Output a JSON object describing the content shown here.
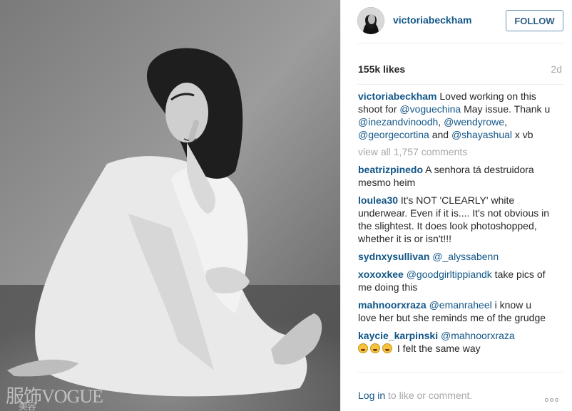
{
  "post": {
    "image_alt": "Black and white photo of a woman sitting on the floor in a white robe",
    "watermark": "服饰VOGUE",
    "watermark_sub": "美容"
  },
  "header": {
    "username": "victoriabeckham",
    "follow_label": "FOLLOW"
  },
  "stats": {
    "likes": "155k likes",
    "time_ago": "2d"
  },
  "caption": {
    "user": "victoriabeckham",
    "text1": " Loved working on this shoot for ",
    "m1": "@voguechina",
    "text2": " May issue. Thank u ",
    "m2": "@inezandvinoodh",
    "text3": ", ",
    "m3": "@wendyrowe",
    "text4": ", ",
    "m4": "@georgecortina",
    "text5": " and ",
    "m5": "@shayashual",
    "text6": " x vb"
  },
  "view_all": "view all 1,757 comments",
  "comments": [
    {
      "user": "beatrizpinedo",
      "mention": "",
      "text": " A senhora tá destruidora mesmo heim"
    },
    {
      "user": "loulea30",
      "mention": "",
      "text": " It's NOT 'CLEARLY' white underwear. Even if it is.... It's not obvious in the slightest. It does look photoshopped, whether it is or isn't!!!"
    },
    {
      "user": "sydnxysullivan",
      "mention": " @_alyssabenn",
      "text": ""
    },
    {
      "user": "xoxoxkee",
      "mention": " @goodgirltippiandk",
      "text": " take pics of me doing this"
    },
    {
      "user": "mahnoorxraza",
      "mention": " @emanraheel",
      "text": " i know u love her but she reminds me of the grudge"
    },
    {
      "user": "kaycie_karpinski",
      "mention": " @mahnoorxraza",
      "text": " I felt the same way"
    }
  ],
  "footer": {
    "login": "Log in",
    "rest": " to like or comment."
  },
  "icons": {
    "more": "more-options-icon",
    "emoji": "laughing-emoji-icon"
  },
  "colors": {
    "link": "#125688",
    "muted": "#a5a7aa",
    "follow_border": "#6f97b6"
  }
}
